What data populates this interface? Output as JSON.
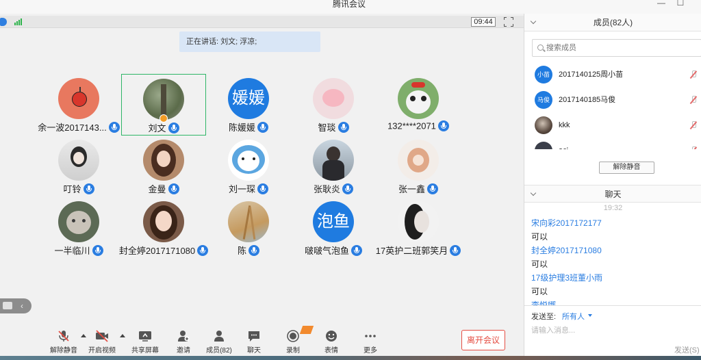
{
  "window": {
    "title": "腾讯会议"
  },
  "status": {
    "time": "09:44"
  },
  "speaking": "正在讲话: 刘文; 浮凉;",
  "participants": [
    {
      "name": "余一波2017143...",
      "avatar_text": ""
    },
    {
      "name": "刘文",
      "avatar_text": ""
    },
    {
      "name": "陈媛媛",
      "avatar_text": "媛媛"
    },
    {
      "name": "智琰",
      "avatar_text": ""
    },
    {
      "name": "132****2071",
      "avatar_text": ""
    },
    {
      "name": "叮铃",
      "avatar_text": ""
    },
    {
      "name": "金曼",
      "avatar_text": ""
    },
    {
      "name": "刘一琛",
      "avatar_text": ""
    },
    {
      "name": "张耿炎",
      "avatar_text": ""
    },
    {
      "name": "张一鑫",
      "avatar_text": ""
    },
    {
      "name": "一半临川",
      "avatar_text": ""
    },
    {
      "name": "封全婷2017171080",
      "avatar_text": ""
    },
    {
      "name": "陈",
      "avatar_text": ""
    },
    {
      "name": "啵啵气泡鱼",
      "avatar_text": "泡鱼"
    },
    {
      "name": "17英护二班郭笑月",
      "avatar_text": ""
    }
  ],
  "toolbar": {
    "unmute": "解除静音",
    "video": "开启视频",
    "share": "共享屏幕",
    "invite": "邀请",
    "members": "成员(82)",
    "chat": "聊天",
    "record": "录制",
    "emoji": "表情",
    "more": "更多",
    "leave": "离开会议"
  },
  "members_panel": {
    "title": "成员(82人)",
    "search_placeholder": "搜索成员",
    "members": [
      {
        "avatar_text": "小苗",
        "name": "2017140125周小苗"
      },
      {
        "avatar_text": "马俊",
        "name": "2017140185马俊"
      },
      {
        "avatar_text": "",
        "name": "kkk"
      },
      {
        "avatar_text": "",
        "name": "acj"
      }
    ],
    "unmute_button": "解除静音"
  },
  "chat_panel": {
    "title": "聊天",
    "time": "19:32",
    "messages": [
      {
        "sender": "宋向彩2017172177",
        "text": "可以"
      },
      {
        "sender": "封全婷2017171080",
        "text": "可以"
      },
      {
        "sender": "17级护理3班董小雨",
        "text": "可以"
      },
      {
        "sender": "李悦娜",
        "text": ""
      }
    ],
    "send_to_label": "发送至:",
    "send_to_value": "所有人",
    "input_placeholder": "请输入消息...",
    "send_button": "发送(S)"
  },
  "colors": {
    "accent": "#2a7de1",
    "leave": "#e54d42",
    "active_border": "#2db566"
  }
}
